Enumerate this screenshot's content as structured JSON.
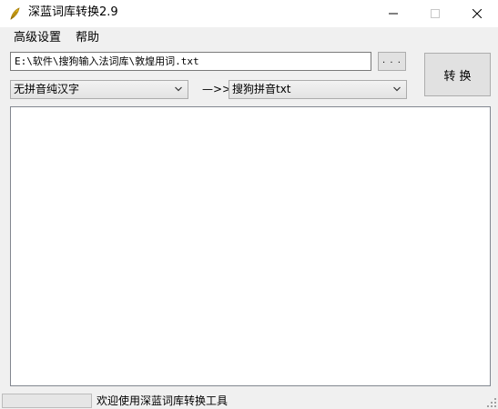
{
  "window": {
    "title": "深蓝词库转换2.9",
    "icon": "feather-app-icon",
    "controls": [
      "minimize-icon",
      "maximize-icon",
      "close-icon"
    ]
  },
  "menu": {
    "items": [
      {
        "label": "高级设置"
      },
      {
        "label": "帮助"
      }
    ]
  },
  "file": {
    "path": "E:\\软件\\搜狗输入法词库\\敦煌用词.txt",
    "browse_label": ". . ."
  },
  "convert": {
    "label": "转 换"
  },
  "format": {
    "from": "无拼音纯汉字",
    "arrow": "—>>",
    "to": "搜狗拼音txt"
  },
  "output": {
    "text": ""
  },
  "status": {
    "message": "欢迎使用深蓝词库转换工具"
  }
}
